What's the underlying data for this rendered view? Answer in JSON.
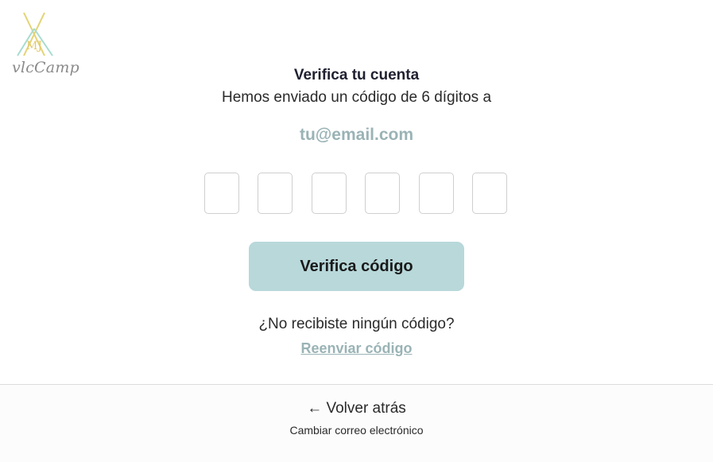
{
  "logo": {
    "monogram": "MJ",
    "brand": "vlcCamp"
  },
  "header": {
    "title": "Verifica tu cuenta",
    "subtitle": "Hemos enviado un código de 6 dígitos a",
    "email": "tu@email.com"
  },
  "code": {
    "digits": [
      "",
      "",
      "",
      "",
      "",
      ""
    ]
  },
  "actions": {
    "verify_label": "Verifica código"
  },
  "resend": {
    "question": "¿No recibiste ningún código?",
    "link_label": "Reenviar código"
  },
  "footer": {
    "back_label": "← Volver atrás",
    "change_email_label": "Cambiar correo electrónico"
  },
  "colors": {
    "accent": "#b8d8da",
    "email_text": "#9ab3b5",
    "logo_yellow": "#e3d374",
    "logo_teal": "#a7dccf"
  }
}
